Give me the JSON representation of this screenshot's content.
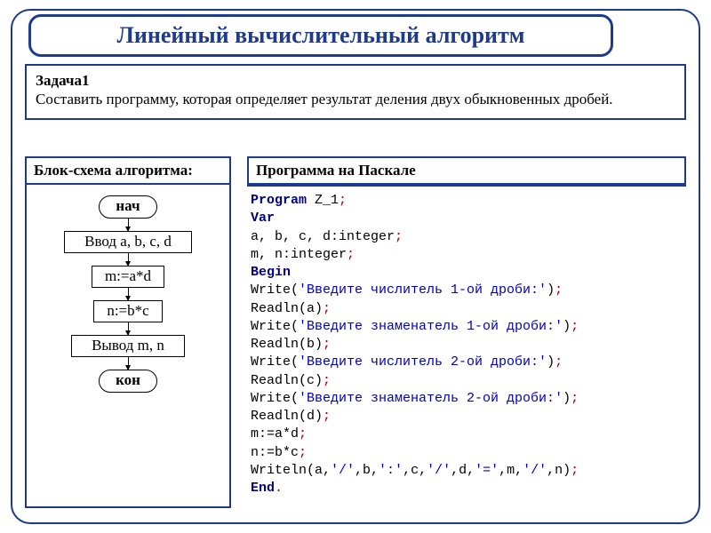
{
  "title": "Линейный вычислительный алгоритм",
  "task": {
    "heading": "Задача1",
    "text": "Составить программу, которая определяет результат деления двух обыкновенных дробей."
  },
  "flowchart": {
    "heading": "Блок-схема алгоритма:",
    "start": "нач",
    "input": "Ввод a, b, c, d",
    "step1": "m:=a*d",
    "step2": "n:=b*c",
    "output": "Вывод m, n",
    "end": "кон"
  },
  "pascal": {
    "heading": "Программа на Паскале",
    "kw_program": "Program",
    "prog_name": " Z_1",
    "kw_var": "Var",
    "decl1": "a, b, c, d:integer",
    "decl2": "m, n:integer",
    "kw_begin": "Begin",
    "w1": "'Введите числитель 1-ой дроби:'",
    "r1": "Readln(a)",
    "w2": "'Введите знаменатель 1-ой дроби:'",
    "r2": "Readln(b)",
    "w3": "'Введите числитель 2-ой дроби:'",
    "r3": "Readln(c)",
    "w4": "'Введите знаменатель 2-ой дроби:'",
    "r4": "Readln(d)",
    "a1": "m:=a*d",
    "a2": "n:=b*c",
    "writeln_call": "Writeln(a,",
    "writeln_s1": "'/'",
    "writeln_mid1": ",b,",
    "writeln_s2": "':'",
    "writeln_mid2": ",c,",
    "writeln_s3": "'/'",
    "writeln_mid3": ",d,",
    "writeln_s4": "'='",
    "writeln_mid4": ",m,",
    "writeln_s5": "'/'",
    "writeln_tail": ",n)",
    "kw_end": "End"
  }
}
